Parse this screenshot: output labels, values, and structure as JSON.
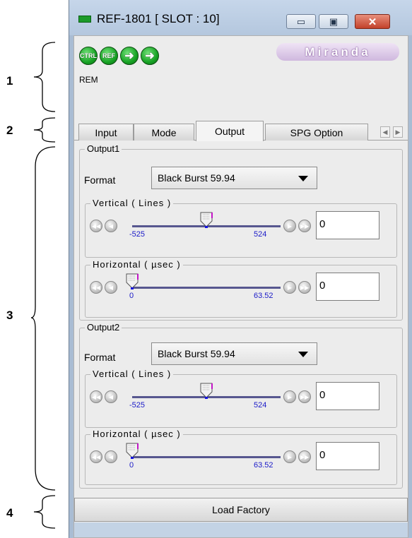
{
  "annotations": [
    "1",
    "2",
    "3",
    "4"
  ],
  "window": {
    "title": "REF-1801 [ SLOT : 10]",
    "minimize_glyph": "▭",
    "restore_glyph": "▣",
    "close_glyph": "✕"
  },
  "status": {
    "leds": [
      {
        "label": "CTRL",
        "icon": "ctrl-led-icon"
      },
      {
        "label": "REF",
        "icon": "ref-led-icon"
      },
      {
        "label": "",
        "icon": "arrow-right-led-icon"
      },
      {
        "label": "",
        "icon": "arrow-right-led-icon"
      }
    ],
    "rem_label": "REM",
    "logo_text": "Miranda"
  },
  "tabs": [
    {
      "label": "Input",
      "active": false
    },
    {
      "label": "Mode",
      "active": false
    },
    {
      "label": "Output",
      "active": true
    },
    {
      "label": "SPG Option",
      "active": false
    }
  ],
  "outputs": [
    {
      "title": "Output1",
      "format_label": "Format",
      "format_value": "Black Burst 59.94",
      "vertical": {
        "title": "Vertical ( Lines )",
        "min": "-525",
        "max": "524",
        "value": "0",
        "fraction": 0.5
      },
      "horizontal": {
        "title": "Horizontal ( µsec )",
        "min": "0",
        "max": "63.52",
        "value": "0",
        "fraction": 0.0
      }
    },
    {
      "title": "Output2",
      "format_label": "Format",
      "format_value": "Black Burst 59.94",
      "vertical": {
        "title": "Vertical ( Lines )",
        "min": "-525",
        "max": "524",
        "value": "0",
        "fraction": 0.5
      },
      "horizontal": {
        "title": "Horizontal ( µsec )",
        "min": "0",
        "max": "63.52",
        "value": "0",
        "fraction": 0.0
      }
    }
  ],
  "load_factory_label": "Load Factory",
  "colors": {
    "led_green": "#17a224",
    "slider_track": "#57578f",
    "tick_blue": "#1a1ac8",
    "window_frame": "#a9bcd3"
  }
}
